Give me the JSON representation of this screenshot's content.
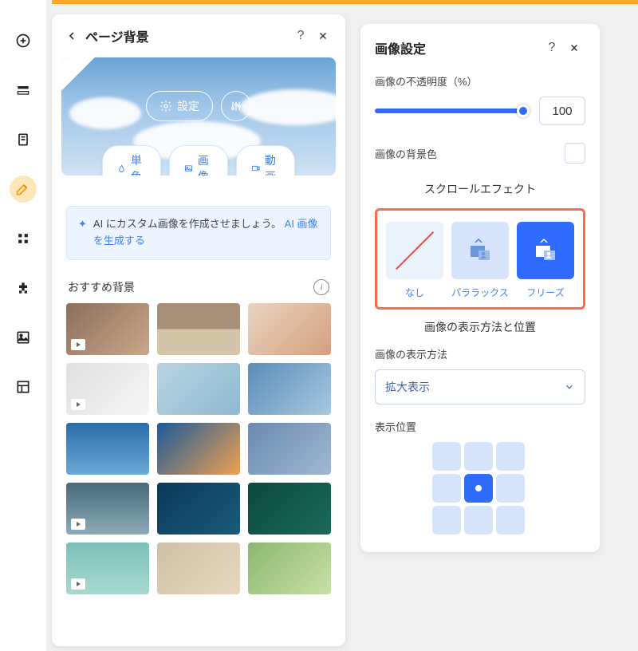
{
  "sidebar": {
    "items": [
      {
        "name": "add"
      },
      {
        "name": "sections"
      },
      {
        "name": "pages"
      },
      {
        "name": "theme",
        "active": true
      },
      {
        "name": "apps"
      },
      {
        "name": "store"
      },
      {
        "name": "media"
      },
      {
        "name": "layout"
      }
    ]
  },
  "leftPanel": {
    "title": "ページ背景",
    "settingsBtn": "設定",
    "bgTypes": {
      "solid": "単色",
      "image": "画像",
      "video": "動画"
    },
    "aiBanner": {
      "text": "AI にカスタム画像を作成させましょう。",
      "link": "AI 画像を生成する"
    },
    "recommendedTitle": "おすすめ背景",
    "thumbnails": [
      {
        "bg": "linear-gradient(135deg,#8b6f5c,#c9a88a)",
        "video": true
      },
      {
        "bg": "linear-gradient(180deg,#a89078 0% 50%,#d4c5a8 50% 100%)",
        "video": false
      },
      {
        "bg": "linear-gradient(135deg,#e8d5c0,#d4a080)",
        "video": false
      },
      {
        "bg": "linear-gradient(135deg,#e0e0e0,#f5f5f5)",
        "video": true
      },
      {
        "bg": "linear-gradient(135deg,#b8d4e3,#8fb8d0)",
        "video": false
      },
      {
        "bg": "linear-gradient(135deg,#5a8db8,#a8c8e0)",
        "video": false
      },
      {
        "bg": "linear-gradient(180deg,#2a6da8,#6aa8d8)",
        "video": false
      },
      {
        "bg": "linear-gradient(135deg,#1a5a9a,#f0a050)",
        "video": false
      },
      {
        "bg": "linear-gradient(135deg,#6a8ab0,#a0b8d0)",
        "video": false
      },
      {
        "bg": "linear-gradient(180deg,#4a6a7a,#8aaab8)",
        "video": true
      },
      {
        "bg": "linear-gradient(135deg,#0a3a5a,#1a5a7a)",
        "video": false
      },
      {
        "bg": "linear-gradient(135deg,#0a4a3a,#1a6a5a)",
        "video": false
      },
      {
        "bg": "linear-gradient(180deg,#7ac0b8,#a8d8d0)",
        "video": true
      },
      {
        "bg": "linear-gradient(135deg,#d0c0a8,#e8d8c0)",
        "video": false
      },
      {
        "bg": "linear-gradient(135deg,#8ab870,#c8e0a8)",
        "video": false
      }
    ]
  },
  "rightPanel": {
    "title": "画像設定",
    "opacityLabel": "画像の不透明度（%）",
    "opacityValue": "100",
    "bgColorLabel": "画像の背景色",
    "scrollEffectTitle": "スクロールエフェクト",
    "scrollOptions": {
      "none": "なし",
      "parallax": "パララックス",
      "freeze": "フリーズ"
    },
    "displaySectionTitle": "画像の表示方法と位置",
    "displayMethodLabel": "画像の表示方法",
    "displayMethodValue": "拡大表示",
    "positionLabel": "表示位置",
    "positionActive": 4
  }
}
